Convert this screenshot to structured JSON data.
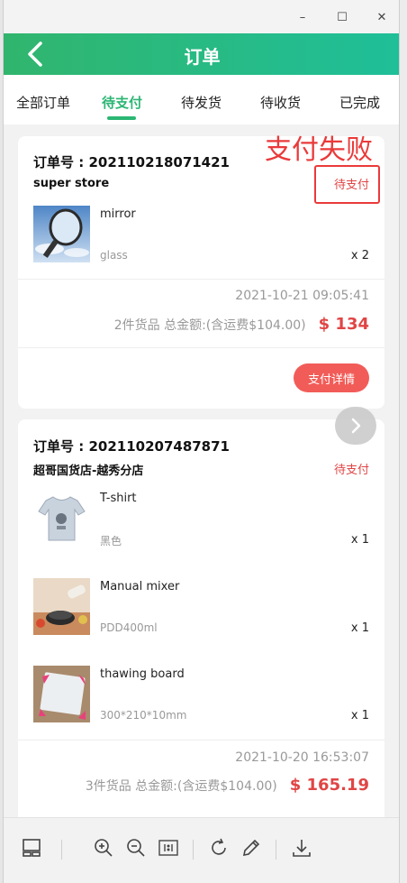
{
  "window": {
    "minimize": "–",
    "maximize": "☐",
    "close": "✕"
  },
  "appbar": {
    "title": "订单",
    "back_icon": "chevron-left-icon"
  },
  "tabs": [
    {
      "label": "全部订单",
      "active": false
    },
    {
      "label": "待支付",
      "active": true
    },
    {
      "label": "待发货",
      "active": false
    },
    {
      "label": "待收货",
      "active": false
    },
    {
      "label": "已完成",
      "active": false
    }
  ],
  "annotation": {
    "text": "支付失败"
  },
  "orders": [
    {
      "order_no": "订单号 : 202110218071421",
      "store": "super store",
      "status": "待支付",
      "items": [
        {
          "name": "mirror",
          "spec": "glass",
          "qty": "x 2"
        }
      ],
      "datetime": "2021-10-21 09:05:41",
      "summary": "2件货品 总金额:(含运费$104.00)",
      "total": "$ 134",
      "action": "支付详情"
    },
    {
      "order_no": "订单号 : 202110207487871",
      "store": "超哥国货店-越秀分店",
      "status": "待支付",
      "items": [
        {
          "name": "T-shirt",
          "spec": "黑色",
          "qty": "x 1"
        },
        {
          "name": "Manual mixer",
          "spec": "PDD400ml",
          "qty": "x 1"
        },
        {
          "name": "thawing board",
          "spec": "300*210*10mm",
          "qty": "x 1"
        }
      ],
      "datetime": "2021-10-20 16:53:07",
      "summary": "3件货品 总金额:(含运费$104.00)",
      "total": "$ 165.19"
    }
  ],
  "toolbar": [
    "thumbnail-icon",
    "zoom-in-icon",
    "zoom-out-icon",
    "actual-size-icon",
    "rotate-icon",
    "edit-icon",
    "download-icon"
  ],
  "colors": {
    "accent": "#2bb673",
    "price": "#e04545",
    "button": "#f25c58",
    "annotation": "#ea3a3a"
  }
}
